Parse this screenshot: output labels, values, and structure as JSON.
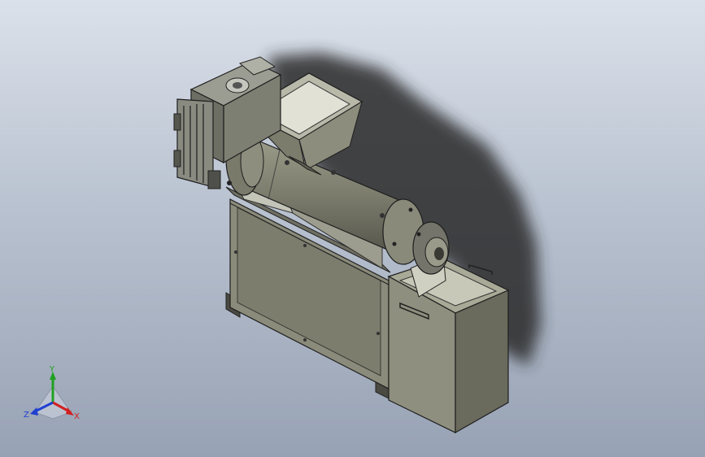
{
  "viewport": {
    "model_name": "screw-press-dewatering-machine",
    "background_top": "#dbe1ea",
    "background_bottom": "#97a2b4"
  },
  "triad": {
    "x_label": "X",
    "y_label": "Y",
    "z_label": "Z",
    "x_color": "#d22020",
    "y_color": "#20a020",
    "z_color": "#2040d0"
  }
}
